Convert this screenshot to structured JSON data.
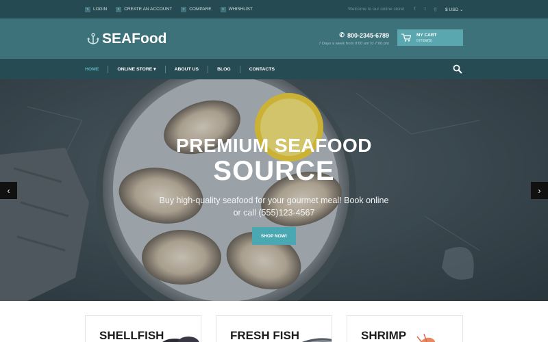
{
  "topbar": {
    "links": [
      "LOGIN",
      "CREATE AN ACCOUNT",
      "COMPARE",
      "WHISHLIST"
    ],
    "welcome": "Welcome to our online store!",
    "social_icons": [
      "facebook-icon",
      "twitter-icon",
      "google-plus-icon"
    ],
    "currency": "$ USD"
  },
  "header": {
    "logo": "SEAFood",
    "phone": "800-2345-6789",
    "hours": "7 Days a week from 9:00 am to 7:00 pm",
    "cart_title": "MY CART",
    "cart_items": "0 ITEM(S)"
  },
  "nav": {
    "items": [
      "HOME",
      "ONLINE STORE",
      "ABOUT US",
      "BLOG",
      "CONTACTS"
    ],
    "dropdown_marker": "▾"
  },
  "hero": {
    "title_line1": "PREMIUM SEAFOOD",
    "title_line2": "SOURCE",
    "text": "Buy high-quality seafood for your gourmet meal! Book online or call (555)123-4567",
    "button": "SHOP NOW!"
  },
  "categories": [
    "SHELLFISH",
    "FRESH FISH",
    "SHRIMP"
  ],
  "colors": {
    "topbar": "#254a52",
    "header": "#3d727b",
    "nav": "#264b53",
    "accent": "#4aa8b2"
  }
}
